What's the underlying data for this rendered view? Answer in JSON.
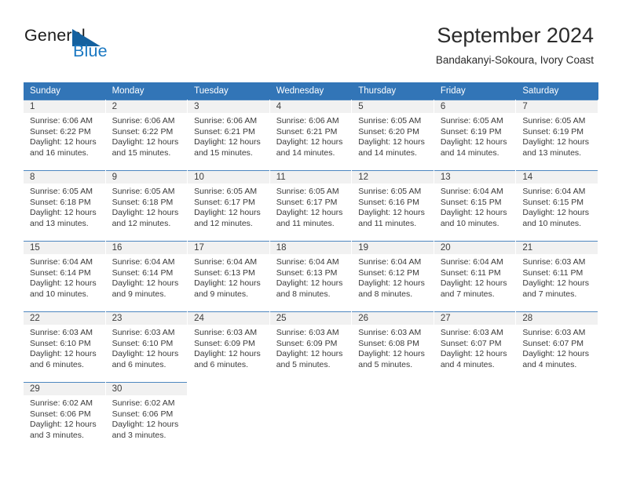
{
  "logo": {
    "word_one": "General",
    "word_two": "Blue",
    "accent_dark": "#15619f",
    "accent_blue": "#1a78c2"
  },
  "header": {
    "month_title": "September 2024",
    "location": "Bandakanyi-Sokoura, Ivory Coast"
  },
  "theme": {
    "header_blue": "#3275b7",
    "daynum_band": "#f1f1f1",
    "row_rule": "#4d87c0",
    "text": "#3a3a3a"
  },
  "calendar": {
    "weekdays": [
      "Sunday",
      "Monday",
      "Tuesday",
      "Wednesday",
      "Thursday",
      "Friday",
      "Saturday"
    ],
    "weeks": [
      [
        {
          "day": "1",
          "sunrise": "Sunrise: 6:06 AM",
          "sunset": "Sunset: 6:22 PM",
          "daylight_1": "Daylight: 12 hours",
          "daylight_2": "and 16 minutes."
        },
        {
          "day": "2",
          "sunrise": "Sunrise: 6:06 AM",
          "sunset": "Sunset: 6:22 PM",
          "daylight_1": "Daylight: 12 hours",
          "daylight_2": "and 15 minutes."
        },
        {
          "day": "3",
          "sunrise": "Sunrise: 6:06 AM",
          "sunset": "Sunset: 6:21 PM",
          "daylight_1": "Daylight: 12 hours",
          "daylight_2": "and 15 minutes."
        },
        {
          "day": "4",
          "sunrise": "Sunrise: 6:06 AM",
          "sunset": "Sunset: 6:21 PM",
          "daylight_1": "Daylight: 12 hours",
          "daylight_2": "and 14 minutes."
        },
        {
          "day": "5",
          "sunrise": "Sunrise: 6:05 AM",
          "sunset": "Sunset: 6:20 PM",
          "daylight_1": "Daylight: 12 hours",
          "daylight_2": "and 14 minutes."
        },
        {
          "day": "6",
          "sunrise": "Sunrise: 6:05 AM",
          "sunset": "Sunset: 6:19 PM",
          "daylight_1": "Daylight: 12 hours",
          "daylight_2": "and 14 minutes."
        },
        {
          "day": "7",
          "sunrise": "Sunrise: 6:05 AM",
          "sunset": "Sunset: 6:19 PM",
          "daylight_1": "Daylight: 12 hours",
          "daylight_2": "and 13 minutes."
        }
      ],
      [
        {
          "day": "8",
          "sunrise": "Sunrise: 6:05 AM",
          "sunset": "Sunset: 6:18 PM",
          "daylight_1": "Daylight: 12 hours",
          "daylight_2": "and 13 minutes."
        },
        {
          "day": "9",
          "sunrise": "Sunrise: 6:05 AM",
          "sunset": "Sunset: 6:18 PM",
          "daylight_1": "Daylight: 12 hours",
          "daylight_2": "and 12 minutes."
        },
        {
          "day": "10",
          "sunrise": "Sunrise: 6:05 AM",
          "sunset": "Sunset: 6:17 PM",
          "daylight_1": "Daylight: 12 hours",
          "daylight_2": "and 12 minutes."
        },
        {
          "day": "11",
          "sunrise": "Sunrise: 6:05 AM",
          "sunset": "Sunset: 6:17 PM",
          "daylight_1": "Daylight: 12 hours",
          "daylight_2": "and 11 minutes."
        },
        {
          "day": "12",
          "sunrise": "Sunrise: 6:05 AM",
          "sunset": "Sunset: 6:16 PM",
          "daylight_1": "Daylight: 12 hours",
          "daylight_2": "and 11 minutes."
        },
        {
          "day": "13",
          "sunrise": "Sunrise: 6:04 AM",
          "sunset": "Sunset: 6:15 PM",
          "daylight_1": "Daylight: 12 hours",
          "daylight_2": "and 10 minutes."
        },
        {
          "day": "14",
          "sunrise": "Sunrise: 6:04 AM",
          "sunset": "Sunset: 6:15 PM",
          "daylight_1": "Daylight: 12 hours",
          "daylight_2": "and 10 minutes."
        }
      ],
      [
        {
          "day": "15",
          "sunrise": "Sunrise: 6:04 AM",
          "sunset": "Sunset: 6:14 PM",
          "daylight_1": "Daylight: 12 hours",
          "daylight_2": "and 10 minutes."
        },
        {
          "day": "16",
          "sunrise": "Sunrise: 6:04 AM",
          "sunset": "Sunset: 6:14 PM",
          "daylight_1": "Daylight: 12 hours",
          "daylight_2": "and 9 minutes."
        },
        {
          "day": "17",
          "sunrise": "Sunrise: 6:04 AM",
          "sunset": "Sunset: 6:13 PM",
          "daylight_1": "Daylight: 12 hours",
          "daylight_2": "and 9 minutes."
        },
        {
          "day": "18",
          "sunrise": "Sunrise: 6:04 AM",
          "sunset": "Sunset: 6:13 PM",
          "daylight_1": "Daylight: 12 hours",
          "daylight_2": "and 8 minutes."
        },
        {
          "day": "19",
          "sunrise": "Sunrise: 6:04 AM",
          "sunset": "Sunset: 6:12 PM",
          "daylight_1": "Daylight: 12 hours",
          "daylight_2": "and 8 minutes."
        },
        {
          "day": "20",
          "sunrise": "Sunrise: 6:04 AM",
          "sunset": "Sunset: 6:11 PM",
          "daylight_1": "Daylight: 12 hours",
          "daylight_2": "and 7 minutes."
        },
        {
          "day": "21",
          "sunrise": "Sunrise: 6:03 AM",
          "sunset": "Sunset: 6:11 PM",
          "daylight_1": "Daylight: 12 hours",
          "daylight_2": "and 7 minutes."
        }
      ],
      [
        {
          "day": "22",
          "sunrise": "Sunrise: 6:03 AM",
          "sunset": "Sunset: 6:10 PM",
          "daylight_1": "Daylight: 12 hours",
          "daylight_2": "and 6 minutes."
        },
        {
          "day": "23",
          "sunrise": "Sunrise: 6:03 AM",
          "sunset": "Sunset: 6:10 PM",
          "daylight_1": "Daylight: 12 hours",
          "daylight_2": "and 6 minutes."
        },
        {
          "day": "24",
          "sunrise": "Sunrise: 6:03 AM",
          "sunset": "Sunset: 6:09 PM",
          "daylight_1": "Daylight: 12 hours",
          "daylight_2": "and 6 minutes."
        },
        {
          "day": "25",
          "sunrise": "Sunrise: 6:03 AM",
          "sunset": "Sunset: 6:09 PM",
          "daylight_1": "Daylight: 12 hours",
          "daylight_2": "and 5 minutes."
        },
        {
          "day": "26",
          "sunrise": "Sunrise: 6:03 AM",
          "sunset": "Sunset: 6:08 PM",
          "daylight_1": "Daylight: 12 hours",
          "daylight_2": "and 5 minutes."
        },
        {
          "day": "27",
          "sunrise": "Sunrise: 6:03 AM",
          "sunset": "Sunset: 6:07 PM",
          "daylight_1": "Daylight: 12 hours",
          "daylight_2": "and 4 minutes."
        },
        {
          "day": "28",
          "sunrise": "Sunrise: 6:03 AM",
          "sunset": "Sunset: 6:07 PM",
          "daylight_1": "Daylight: 12 hours",
          "daylight_2": "and 4 minutes."
        }
      ],
      [
        {
          "day": "29",
          "sunrise": "Sunrise: 6:02 AM",
          "sunset": "Sunset: 6:06 PM",
          "daylight_1": "Daylight: 12 hours",
          "daylight_2": "and 3 minutes."
        },
        {
          "day": "30",
          "sunrise": "Sunrise: 6:02 AM",
          "sunset": "Sunset: 6:06 PM",
          "daylight_1": "Daylight: 12 hours",
          "daylight_2": "and 3 minutes."
        },
        {
          "day": "",
          "sunrise": "",
          "sunset": "",
          "daylight_1": "",
          "daylight_2": ""
        },
        {
          "day": "",
          "sunrise": "",
          "sunset": "",
          "daylight_1": "",
          "daylight_2": ""
        },
        {
          "day": "",
          "sunrise": "",
          "sunset": "",
          "daylight_1": "",
          "daylight_2": ""
        },
        {
          "day": "",
          "sunrise": "",
          "sunset": "",
          "daylight_1": "",
          "daylight_2": ""
        },
        {
          "day": "",
          "sunrise": "",
          "sunset": "",
          "daylight_1": "",
          "daylight_2": ""
        }
      ]
    ]
  }
}
